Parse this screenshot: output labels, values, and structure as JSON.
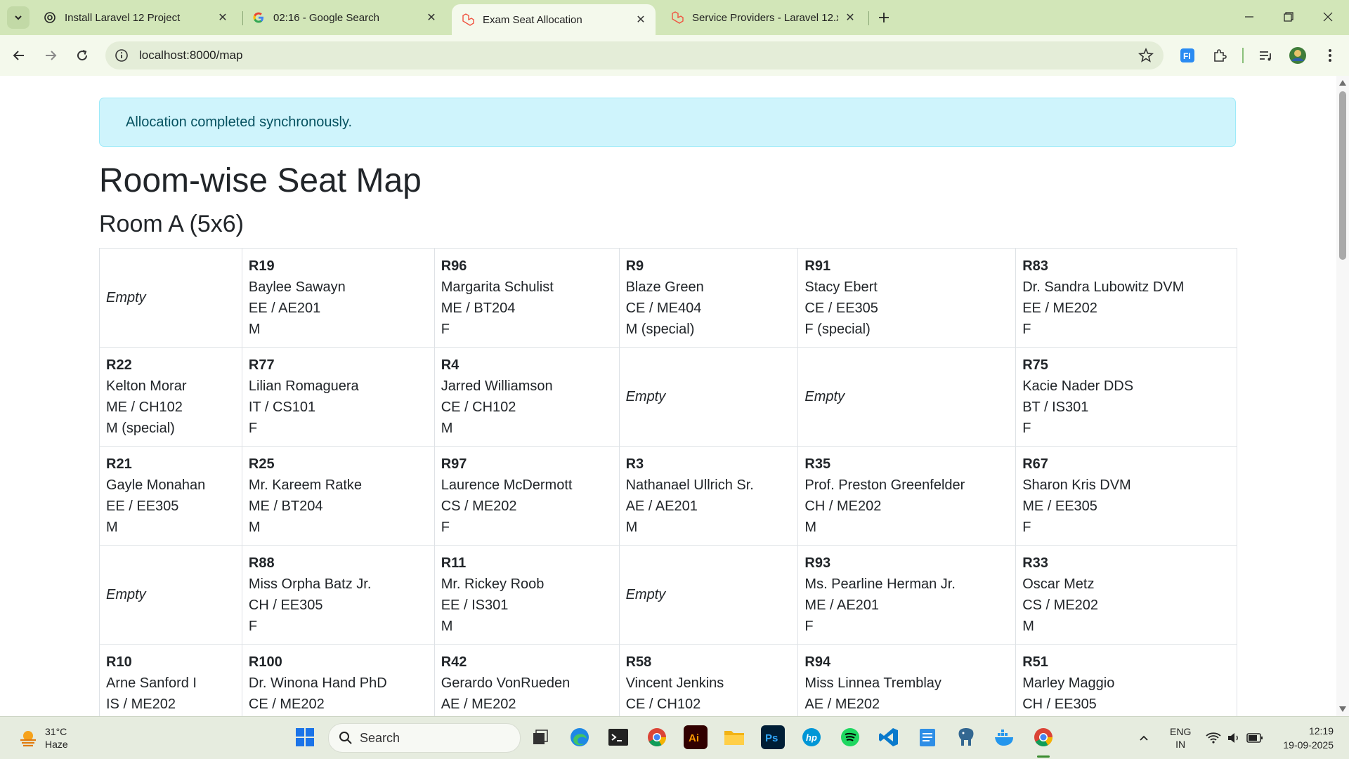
{
  "browser": {
    "tabs": [
      {
        "title": "Install Laravel 12 Project",
        "favicon": "openai-icon",
        "active": false
      },
      {
        "title": "02:16 - Google Search",
        "favicon": "google-icon",
        "active": false
      },
      {
        "title": "Exam Seat Allocation",
        "favicon": "laravel-icon",
        "active": true
      },
      {
        "title": "Service Providers - Laravel 12.x",
        "favicon": "laravel-icon",
        "active": false
      }
    ],
    "url": "localhost:8000/map",
    "accent": "#d2e6b8"
  },
  "page": {
    "alert": "Allocation completed synchronously.",
    "heading": "Room-wise Seat Map",
    "room_title": "Room A (5x6)",
    "empty_label": "Empty",
    "rows": [
      [
        {
          "empty": true
        },
        {
          "roll": "R19",
          "name": "Baylee Sawayn",
          "course": "EE / AE201",
          "gender": "M"
        },
        {
          "roll": "R96",
          "name": "Margarita Schulist",
          "course": "ME / BT204",
          "gender": "F"
        },
        {
          "roll": "R9",
          "name": "Blaze Green",
          "course": "CE / ME404",
          "gender": "M (special)"
        },
        {
          "roll": "R91",
          "name": "Stacy Ebert",
          "course": "CE / EE305",
          "gender": "F (special)"
        },
        {
          "roll": "R83",
          "name": "Dr. Sandra Lubowitz DVM",
          "course": "EE / ME202",
          "gender": "F"
        }
      ],
      [
        {
          "roll": "R22",
          "name": "Kelton Morar",
          "course": "ME / CH102",
          "gender": "M (special)"
        },
        {
          "roll": "R77",
          "name": "Lilian Romaguera",
          "course": "IT / CS101",
          "gender": "F"
        },
        {
          "roll": "R4",
          "name": "Jarred Williamson",
          "course": "CE / CH102",
          "gender": "M"
        },
        {
          "empty": true
        },
        {
          "empty": true
        },
        {
          "roll": "R75",
          "name": "Kacie Nader DDS",
          "course": "BT / IS301",
          "gender": "F"
        }
      ],
      [
        {
          "roll": "R21",
          "name": "Gayle Monahan",
          "course": "EE / EE305",
          "gender": "M"
        },
        {
          "roll": "R25",
          "name": "Mr. Kareem Ratke",
          "course": "ME / BT204",
          "gender": "M"
        },
        {
          "roll": "R97",
          "name": "Laurence McDermott",
          "course": "CS / ME202",
          "gender": "F"
        },
        {
          "roll": "R3",
          "name": "Nathanael Ullrich Sr.",
          "course": "AE / AE201",
          "gender": "M"
        },
        {
          "roll": "R35",
          "name": "Prof. Preston Greenfelder",
          "course": "CH / ME202",
          "gender": "M"
        },
        {
          "roll": "R67",
          "name": "Sharon Kris DVM",
          "course": "ME / EE305",
          "gender": "F"
        }
      ],
      [
        {
          "empty": true
        },
        {
          "roll": "R88",
          "name": "Miss Orpha Batz Jr.",
          "course": "CH / EE305",
          "gender": "F"
        },
        {
          "roll": "R11",
          "name": "Mr. Rickey Roob",
          "course": "EE / IS301",
          "gender": "M"
        },
        {
          "empty": true
        },
        {
          "roll": "R93",
          "name": "Ms. Pearline Herman Jr.",
          "course": "ME / AE201",
          "gender": "F"
        },
        {
          "roll": "R33",
          "name": "Oscar Metz",
          "course": "CS / ME202",
          "gender": "M"
        }
      ],
      [
        {
          "roll": "R10",
          "name": "Arne Sanford I",
          "course": "IS / ME202",
          "gender": ""
        },
        {
          "roll": "R100",
          "name": "Dr. Winona Hand PhD",
          "course": "CE / ME202",
          "gender": ""
        },
        {
          "roll": "R42",
          "name": "Gerardo VonRueden",
          "course": "AE / ME202",
          "gender": ""
        },
        {
          "roll": "R58",
          "name": "Vincent Jenkins",
          "course": "CE / CH102",
          "gender": ""
        },
        {
          "roll": "R94",
          "name": "Miss Linnea Tremblay",
          "course": "AE / ME202",
          "gender": ""
        },
        {
          "roll": "R51",
          "name": "Marley Maggio",
          "course": "CH / EE305",
          "gender": ""
        }
      ]
    ]
  },
  "taskbar": {
    "weather_temp": "31°C",
    "weather_desc": "Haze",
    "search_placeholder": "Search",
    "lang_top": "ENG",
    "lang_bottom": "IN",
    "time": "12:19",
    "date": "19-09-2025"
  }
}
